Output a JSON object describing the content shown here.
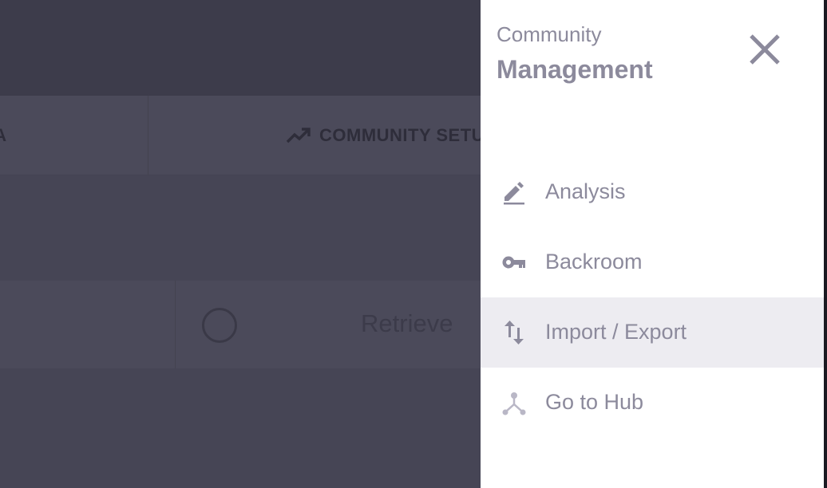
{
  "background": {
    "tabs": [
      {
        "label": "TA",
        "icon": "none"
      },
      {
        "label": "COMMUNITY SETU",
        "icon": "trending-up-icon"
      }
    ],
    "retrieve_label": "Retrieve"
  },
  "drawer": {
    "supertitle": "Community",
    "title": "Management",
    "close_icon": "close-icon",
    "items": [
      {
        "label": "Analysis",
        "icon": "pencil-icon",
        "active": false
      },
      {
        "label": "Backroom",
        "icon": "key-icon",
        "active": false
      },
      {
        "label": "Import / Export",
        "icon": "swap-vertical-icon",
        "active": true
      },
      {
        "label": "Go to Hub",
        "icon": "hub-icon",
        "active": false
      }
    ]
  },
  "colors": {
    "overlay_bg": "#464555",
    "drawer_bg": "#ffffff",
    "text_muted": "#8c8a9c",
    "active_item_bg": "#edecf1"
  }
}
